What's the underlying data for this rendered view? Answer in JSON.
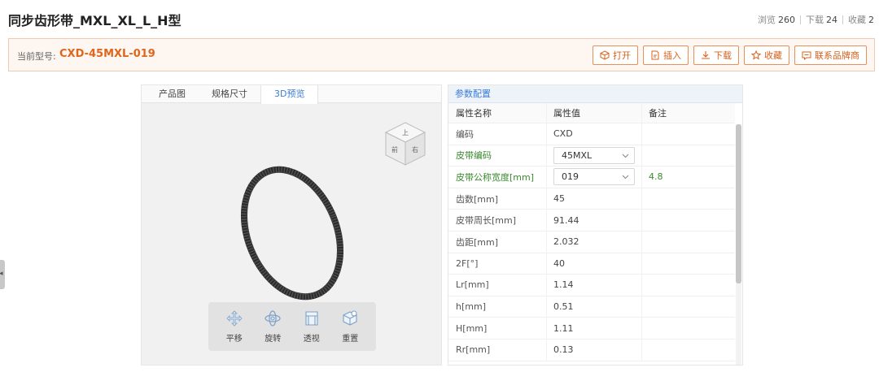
{
  "page": {
    "title": "同步齿形带_MXL_XL_L_H型",
    "stats": [
      {
        "label": "浏览",
        "value": "260"
      },
      {
        "label": "下载",
        "value": "24"
      },
      {
        "label": "收藏",
        "value": "2"
      }
    ]
  },
  "model": {
    "label": "当前型号:",
    "value": "CXD-45MXL-019"
  },
  "actions": {
    "open": "打开",
    "insert": "插入",
    "download": "下载",
    "favorite": "收藏",
    "contact": "联系品牌商"
  },
  "viewer": {
    "tabs": [
      {
        "label": "产品图"
      },
      {
        "label": "规格尺寸"
      },
      {
        "label": "3D预览"
      }
    ],
    "active_tab": 2,
    "cube_faces": {
      "top": "上",
      "front": "前",
      "right": "右"
    },
    "tools": [
      {
        "label": "平移",
        "icon": "pan-icon"
      },
      {
        "label": "旋转",
        "icon": "rotate-icon"
      },
      {
        "label": "透视",
        "icon": "perspective-icon"
      },
      {
        "label": "重置",
        "icon": "reset-icon"
      }
    ]
  },
  "params": {
    "section_title": "参数配置",
    "columns": [
      "属性名称",
      "属性值",
      "备注"
    ],
    "rows": [
      {
        "name": "编码",
        "value": "CXD",
        "note": "",
        "select": false,
        "highlight": false
      },
      {
        "name": "皮带编码",
        "value": "45MXL",
        "note": "",
        "select": true,
        "highlight": true
      },
      {
        "name": "皮带公称宽度[mm]",
        "value": "019",
        "note": "4.8",
        "select": true,
        "highlight": true
      },
      {
        "name": "齿数[mm]",
        "value": "45",
        "note": "",
        "select": false,
        "highlight": false
      },
      {
        "name": "皮带周长[mm]",
        "value": "91.44",
        "note": "",
        "select": false,
        "highlight": false
      },
      {
        "name": "齿距[mm]",
        "value": "2.032",
        "note": "",
        "select": false,
        "highlight": false
      },
      {
        "name": "2F[°]",
        "value": "40",
        "note": "",
        "select": false,
        "highlight": false
      },
      {
        "name": "Lr[mm]",
        "value": "1.14",
        "note": "",
        "select": false,
        "highlight": false
      },
      {
        "name": "h[mm]",
        "value": "0.51",
        "note": "",
        "select": false,
        "highlight": false
      },
      {
        "name": "H[mm]",
        "value": "1.11",
        "note": "",
        "select": false,
        "highlight": false
      },
      {
        "name": "Rr[mm]",
        "value": "0.13",
        "note": "",
        "select": false,
        "highlight": false
      }
    ]
  },
  "colors": {
    "accent": "#e0661c",
    "link_blue": "#3a7bd5",
    "green": "#3a8a2f"
  }
}
